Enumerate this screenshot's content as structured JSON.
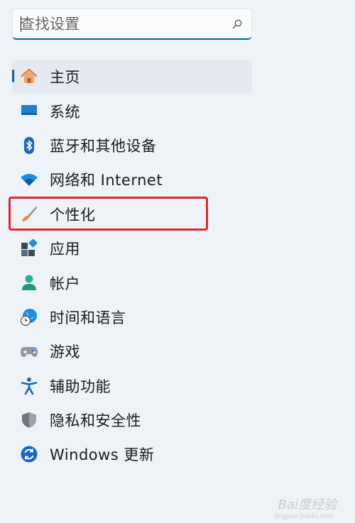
{
  "search": {
    "placeholder": "查找设置",
    "icon": "search-icon"
  },
  "nav": {
    "selected_index": 0,
    "items": [
      {
        "label": "主页",
        "icon": "home-icon"
      },
      {
        "label": "系统",
        "icon": "monitor-icon"
      },
      {
        "label": "蓝牙和其他设备",
        "icon": "bluetooth-icon"
      },
      {
        "label": "网络和 Internet",
        "icon": "wifi-icon"
      },
      {
        "label": "个性化",
        "icon": "brush-icon"
      },
      {
        "label": "应用",
        "icon": "apps-icon"
      },
      {
        "label": "帐户",
        "icon": "account-icon"
      },
      {
        "label": "时间和语言",
        "icon": "globe-clock-icon"
      },
      {
        "label": "游戏",
        "icon": "gamepad-icon"
      },
      {
        "label": "辅助功能",
        "icon": "accessibility-icon"
      },
      {
        "label": "隐私和安全性",
        "icon": "shield-icon"
      },
      {
        "label": "Windows 更新",
        "icon": "windows-update-icon"
      }
    ]
  },
  "colors": {
    "accent": "#006aa8",
    "highlight_box": "#e0262e",
    "background": "#eef3f8"
  },
  "watermark": {
    "text": "Bai度经验",
    "sub": "jingyan.baidu.com"
  }
}
